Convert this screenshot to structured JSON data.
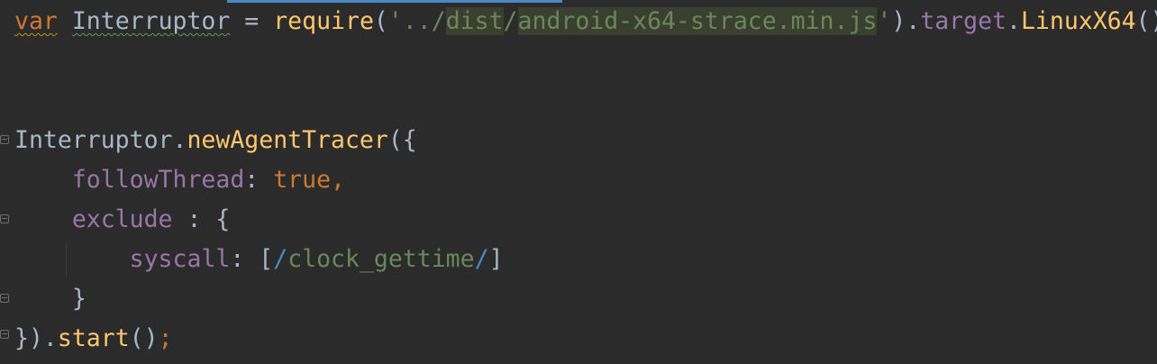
{
  "code": {
    "line1": {
      "kw_var": "var",
      "ident": "Interruptor",
      "eq": " = ",
      "fn_require": "require",
      "open": "(",
      "str_prefix": "'../",
      "str_dist": "dist",
      "str_slash": "/",
      "str_file": "android-x64-strace.min.js",
      "str_end": "'",
      "close": ").",
      "prop_target": "target",
      "dot": ".",
      "fn_linux": "LinuxX64",
      "call": "()",
      "semi": ";"
    },
    "line4": {
      "ident": "Interruptor",
      "dot": ".",
      "fn": "newAgentTracer",
      "open": "({"
    },
    "line5": {
      "prop": "followThread",
      "colon": ": ",
      "val": "true",
      "comma": ","
    },
    "line6": {
      "prop": "exclude",
      "rest": " : {"
    },
    "line7": {
      "prop": "syscall",
      "colon": ": ",
      "open": "[",
      "slash1": "/",
      "regex": "clock_gettime",
      "slash2": "/",
      "close": "]"
    },
    "line8": {
      "brace": "}"
    },
    "line9": {
      "close": "}).",
      "fn": "start",
      "call": "()",
      "semi": ";"
    }
  }
}
